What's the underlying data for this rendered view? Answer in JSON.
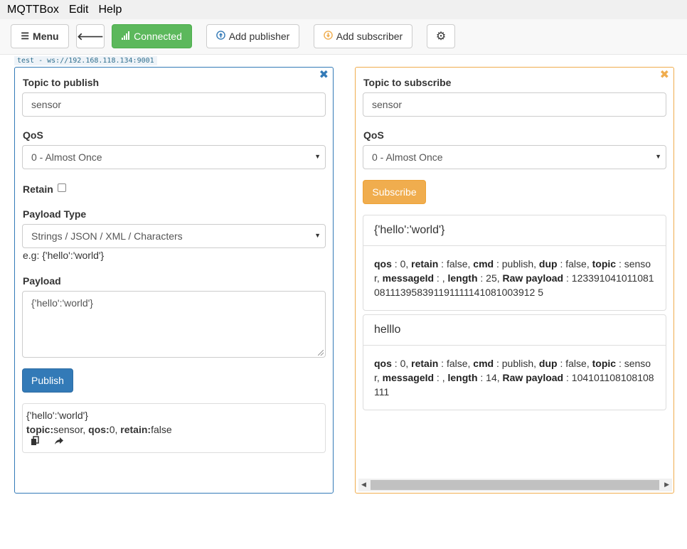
{
  "menubar": {
    "items": [
      "MQTTBox",
      "Edit",
      "Help"
    ]
  },
  "toolbar": {
    "menu_label": "Menu",
    "connected_label": "Connected",
    "add_publisher_label": "Add publisher",
    "add_subscriber_label": "Add subscriber"
  },
  "connection": {
    "tag": "test - ws://192.168.118.134:9001"
  },
  "publisher": {
    "topic_label": "Topic to publish",
    "topic_value": "sensor",
    "qos_label": "QoS",
    "qos_value": "0 - Almost Once",
    "retain_label": "Retain",
    "payload_type_label": "Payload Type",
    "payload_type_value": "Strings / JSON / XML / Characters",
    "example": "e.g: {'hello':'world'}",
    "payload_label": "Payload",
    "payload_value": "{'hello':'world'}",
    "publish_label": "Publish",
    "history": {
      "payload": "{'hello':'world'}",
      "topic_key": "topic:",
      "topic_val": "sensor",
      "qos_key": "qos:",
      "qos_val": "0",
      "retain_key": "retain:",
      "retain_val": "false"
    }
  },
  "subscriber": {
    "topic_label": "Topic to subscribe",
    "topic_value": "sensor",
    "qos_label": "QoS",
    "qos_value": "0 - Almost Once",
    "subscribe_label": "Subscribe",
    "messages": [
      {
        "payload": "{'hello':'world'}",
        "qos": "0",
        "retain": "false",
        "cmd": "publish",
        "dup": "false",
        "topic": "sensor",
        "messageId": "",
        "length": "25",
        "raw": "123391041011081081113958391191111141081003912 5"
      },
      {
        "payload": "helllo",
        "qos": "0",
        "retain": "false",
        "cmd": "publish",
        "dup": "false",
        "topic": "sensor",
        "messageId": "",
        "length": "14",
        "raw": "104101108108108111"
      }
    ]
  },
  "colors": {
    "publisher_border": "#337ab7",
    "subscriber_border": "#f0ad4e",
    "connected": "#5cb85c"
  }
}
